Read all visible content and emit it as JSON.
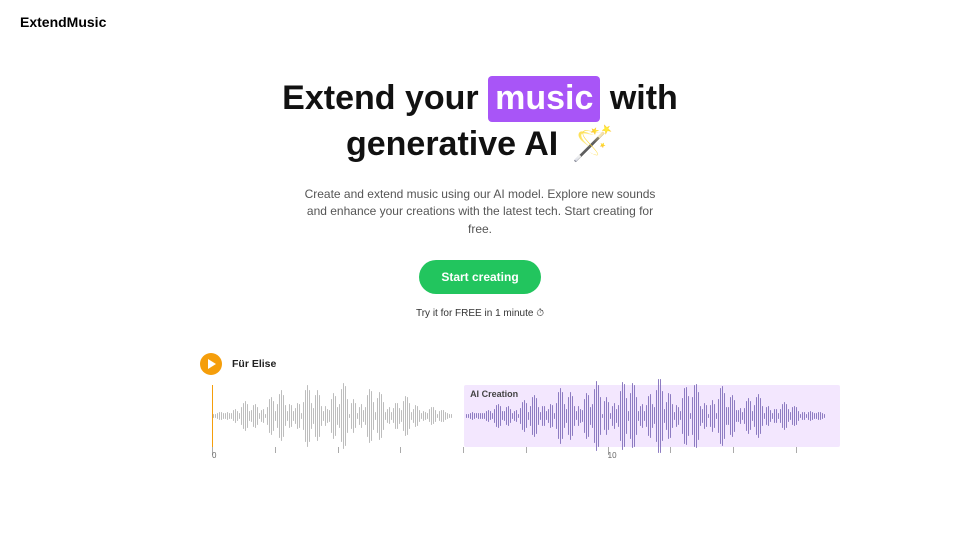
{
  "brand": "ExtendMusic",
  "headline": {
    "pre": "Extend your ",
    "highlight": "music",
    "mid": " with generative AI ",
    "emoji": "🪄"
  },
  "subtext": "Create and extend music using our AI model. Explore new sounds and enhance your creations with the latest tech. Start creating for free.",
  "cta_label": "Start creating",
  "try_text": "Try it for FREE in 1 minute ⏱",
  "track": {
    "title": "Für Elise",
    "ai_label": "AI Creation"
  },
  "ruler": {
    "start": "0",
    "end": "10"
  },
  "colors": {
    "accent": "#a855f7",
    "cta": "#22c55e",
    "play": "#f59e0b"
  }
}
